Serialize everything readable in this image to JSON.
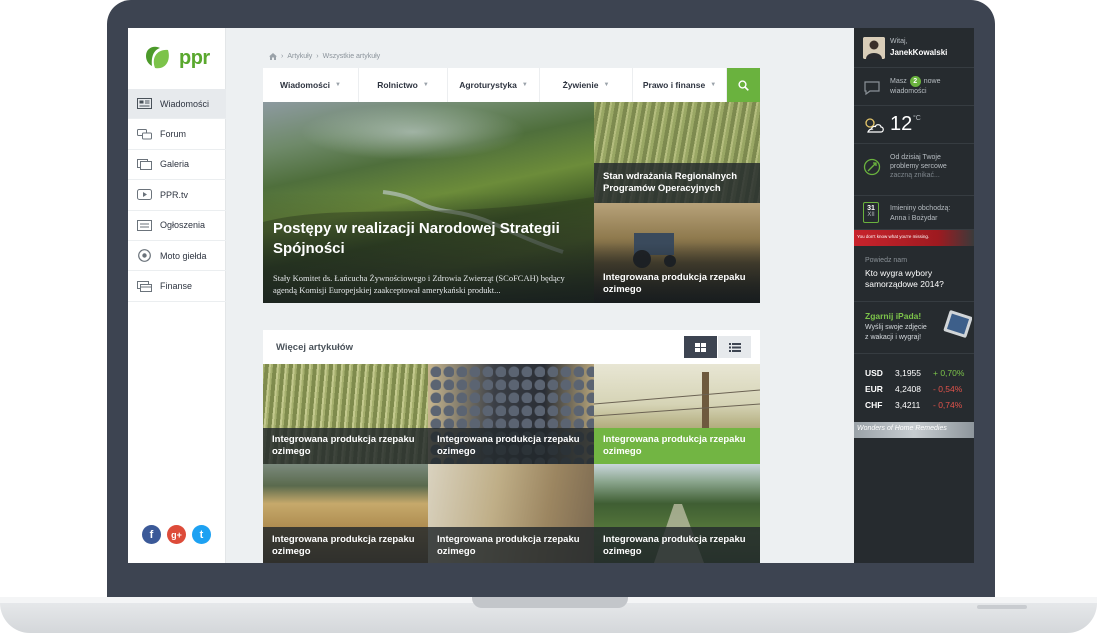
{
  "logo": {
    "text": "ppr"
  },
  "sidebar": {
    "items": [
      {
        "label": "Wiadomości",
        "icon": "news-icon",
        "active": true
      },
      {
        "label": "Forum",
        "icon": "chat-bubbles-icon",
        "active": false
      },
      {
        "label": "Galeria",
        "icon": "gallery-icon",
        "active": false
      },
      {
        "label": "PPR.tv",
        "icon": "play-icon",
        "active": false
      },
      {
        "label": "Ogłoszenia",
        "icon": "board-icon",
        "active": false
      },
      {
        "label": "Moto giełda",
        "icon": "wheel-icon",
        "active": false
      },
      {
        "label": "Finanse",
        "icon": "cards-icon",
        "active": false
      }
    ],
    "social": [
      {
        "glyph": "f",
        "icon": "facebook-icon",
        "color": "#3b5998"
      },
      {
        "glyph": "g+",
        "icon": "google-plus-icon",
        "color": "#dd4b39"
      },
      {
        "glyph": "t",
        "icon": "twitter-icon",
        "color": "#1da1f2"
      }
    ]
  },
  "breadcrumb": {
    "sep1": "›",
    "item1": "Artykuły",
    "sep2": "›",
    "item2": "Wszystkie artykuły"
  },
  "topnav": {
    "items": [
      {
        "label": "Wiadomości",
        "caret": "▼"
      },
      {
        "label": "Rolnictwo",
        "caret": "▼"
      },
      {
        "label": "Agroturystyka",
        "caret": "▼"
      },
      {
        "label": "Żywienie",
        "caret": "▼"
      },
      {
        "label": "Prawo i finanse",
        "caret": "▼"
      }
    ]
  },
  "hero": {
    "title": "Postępy w realizacji Narodowej Strategii Spójności",
    "desc": "Stały Komitet ds. Łańcucha Żywnościowego i Zdrowia Zwierząt (SCoFCAH) będący agendą Komisji Europejskiej zaakceptował amerykański produkt..."
  },
  "side_tiles": [
    {
      "title": "Stan wdrażania Regionalnych Programów Operacyjnych"
    },
    {
      "title": "Integrowana produkcja rzepaku ozimego"
    }
  ],
  "more": {
    "title": "Więcej artykułów",
    "tiles": [
      {
        "title": "Integrowana produkcja rzepaku ozimego"
      },
      {
        "title": "Integrowana produkcja rzepaku ozimego"
      },
      {
        "title": "Integrowana produkcja rzepaku ozimego"
      },
      {
        "title": "Integrowana produkcja rzepaku ozimego"
      },
      {
        "title": "Integrowana produkcja rzepaku ozimego"
      },
      {
        "title": "Integrowana produkcja rzepaku ozimego"
      }
    ]
  },
  "right": {
    "user": {
      "greeting": "Witaj,",
      "name": "JanekKowalski"
    },
    "messages": {
      "pre": "Masz",
      "count": "2",
      "post": "nowe",
      "line2": "wiadomości"
    },
    "weather": {
      "temp": "12",
      "unit": "°C"
    },
    "heart": {
      "line1": "Od dzisiaj Twoje",
      "line2": "problemy sercowe",
      "line3": "zaczną znikać..."
    },
    "calendar": {
      "day": "31",
      "month": "XII",
      "line1": "Imieniny obchodzą:",
      "line2": "Anna i Bożydar"
    },
    "ad1": {
      "text": "You don't know what you're missing."
    },
    "poll": {
      "label": "Powiedz nam",
      "question": "Kto wygra wybory samorządowe 2014?"
    },
    "ipad": {
      "title": "Zgarnij iPada!",
      "line1": "Wyślij swoje zdjęcie",
      "line2": "z wakacji i wygraj!"
    },
    "fx": [
      {
        "code": "USD",
        "value": "3,1955",
        "change": "+ 0,70%",
        "dir": "up"
      },
      {
        "code": "EUR",
        "value": "4,2408",
        "change": "- 0,54%",
        "dir": "down"
      },
      {
        "code": "CHF",
        "value": "3,4211",
        "change": "- 0,74%",
        "dir": "down"
      }
    ],
    "ad2": {
      "text": "Wonders of Home Remedies"
    }
  },
  "colors": {
    "accent": "#6ab23e",
    "dark_panel": "#262b2f",
    "frame": "#3d4451",
    "up": "#7cc34a",
    "down": "#e2534b"
  }
}
